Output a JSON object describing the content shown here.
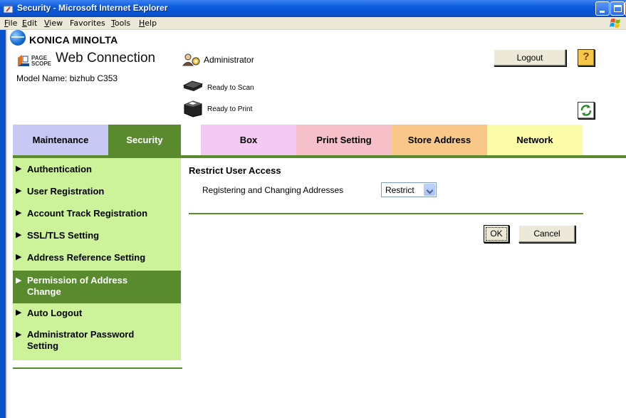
{
  "window": {
    "title": "Security - Microsoft Internet Explorer"
  },
  "menubar": {
    "items": [
      {
        "label_first": "F",
        "label_rest": "ile"
      },
      {
        "label_first": "E",
        "label_rest": "dit"
      },
      {
        "label_first": "V",
        "label_rest": "iew"
      },
      {
        "label_first": "Fa",
        "label_rest": "vorites",
        "underline_index": 1
      },
      {
        "label_first": "T",
        "label_rest": "ools"
      },
      {
        "label_first": "H",
        "label_rest": "elp"
      }
    ]
  },
  "header": {
    "brand": "KONICA MINOLTA",
    "pagescope_small_1": "PAGE",
    "pagescope_small_2": "SCOPE",
    "product": "Web Connection",
    "model": "Model Name: bizhub C353",
    "user": "Administrator",
    "scan_status": "Ready to Scan",
    "print_status": "Ready to Print",
    "logout_label": "Logout",
    "help_label": "?"
  },
  "tabs": [
    {
      "label": "Maintenance",
      "active": false,
      "color": "#c8c8f4"
    },
    {
      "label": "Security",
      "active": true,
      "color": "#5a8a2e"
    },
    {
      "label": "Box",
      "active": false,
      "color": "#f3c8f3"
    },
    {
      "label": "Print Setting",
      "active": false,
      "color": "#f7c0c8"
    },
    {
      "label": "Store Address",
      "active": false,
      "color": "#f9c888"
    },
    {
      "label": "Network",
      "active": false,
      "color": "#fbfba8"
    }
  ],
  "sidebar": {
    "items": [
      {
        "label": "Authentication",
        "active": false
      },
      {
        "label": "User Registration",
        "active": false
      },
      {
        "label": "Account Track Registration",
        "active": false
      },
      {
        "label": "SSL/TLS Setting",
        "active": false
      },
      {
        "label": "Address Reference Setting",
        "active": false
      },
      {
        "label": "Permission of Address Change",
        "active": true
      },
      {
        "label": "Auto Logout",
        "active": false
      },
      {
        "label": "Administrator Password Setting",
        "active": false
      }
    ]
  },
  "main": {
    "section_title": "Restrict User Access",
    "field_label": "Registering and Changing Addresses",
    "select_value": "Restrict",
    "ok_label": "OK",
    "cancel_label": "Cancel"
  },
  "colors": {
    "accent_green": "#5a8a2e",
    "sidebar_bg": "#ccf29a",
    "titlebar_blue": "#0a52cc"
  }
}
